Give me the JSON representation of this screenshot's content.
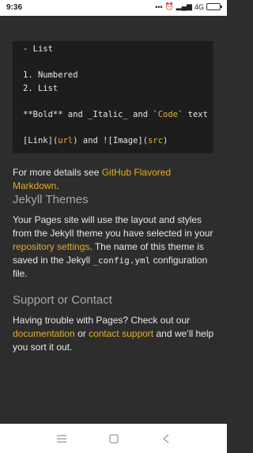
{
  "status_bar": {
    "time": "9:36",
    "network": "4G"
  },
  "code_block": {
    "lines": [
      "- List",
      "",
      "1. Numbered",
      "2. List",
      "",
      "**Bold** and _Italic_ and `Code` text",
      "",
      "[Link](url) and ![Image](src)"
    ],
    "code_word": "Code",
    "link_text": "[Link]",
    "url": "url",
    "and": " and ",
    "image_text": "![Image]",
    "src": "src",
    "paren_open": "(",
    "paren_close": ")"
  },
  "more_details": {
    "prefix": "For more details see ",
    "link": "GitHub Flavored Markdown",
    "suffix": "."
  },
  "jekyll_section": {
    "title": "Jekyll Themes",
    "text1": "Your Pages site will use the layout and styles from the Jekyll theme you have selected in your ",
    "link": "repository settings",
    "text2": ". The name of this theme is saved in the Jekyll ",
    "code": "_config.yml",
    "text3": " configuration file."
  },
  "support_section": {
    "title": "Support or Contact",
    "text1": "Having trouble with Pages? Check out our ",
    "link1": "documentation",
    "text2": " or ",
    "link2": "contact support",
    "text3": " and we’ll help you sort it out."
  },
  "colors": {
    "accent": "#e3ae29",
    "background": "#2d2d2d",
    "code_bg": "#1d1d1d"
  },
  "nav_icons": [
    "menu-icon",
    "home-square-icon",
    "back-icon"
  ]
}
